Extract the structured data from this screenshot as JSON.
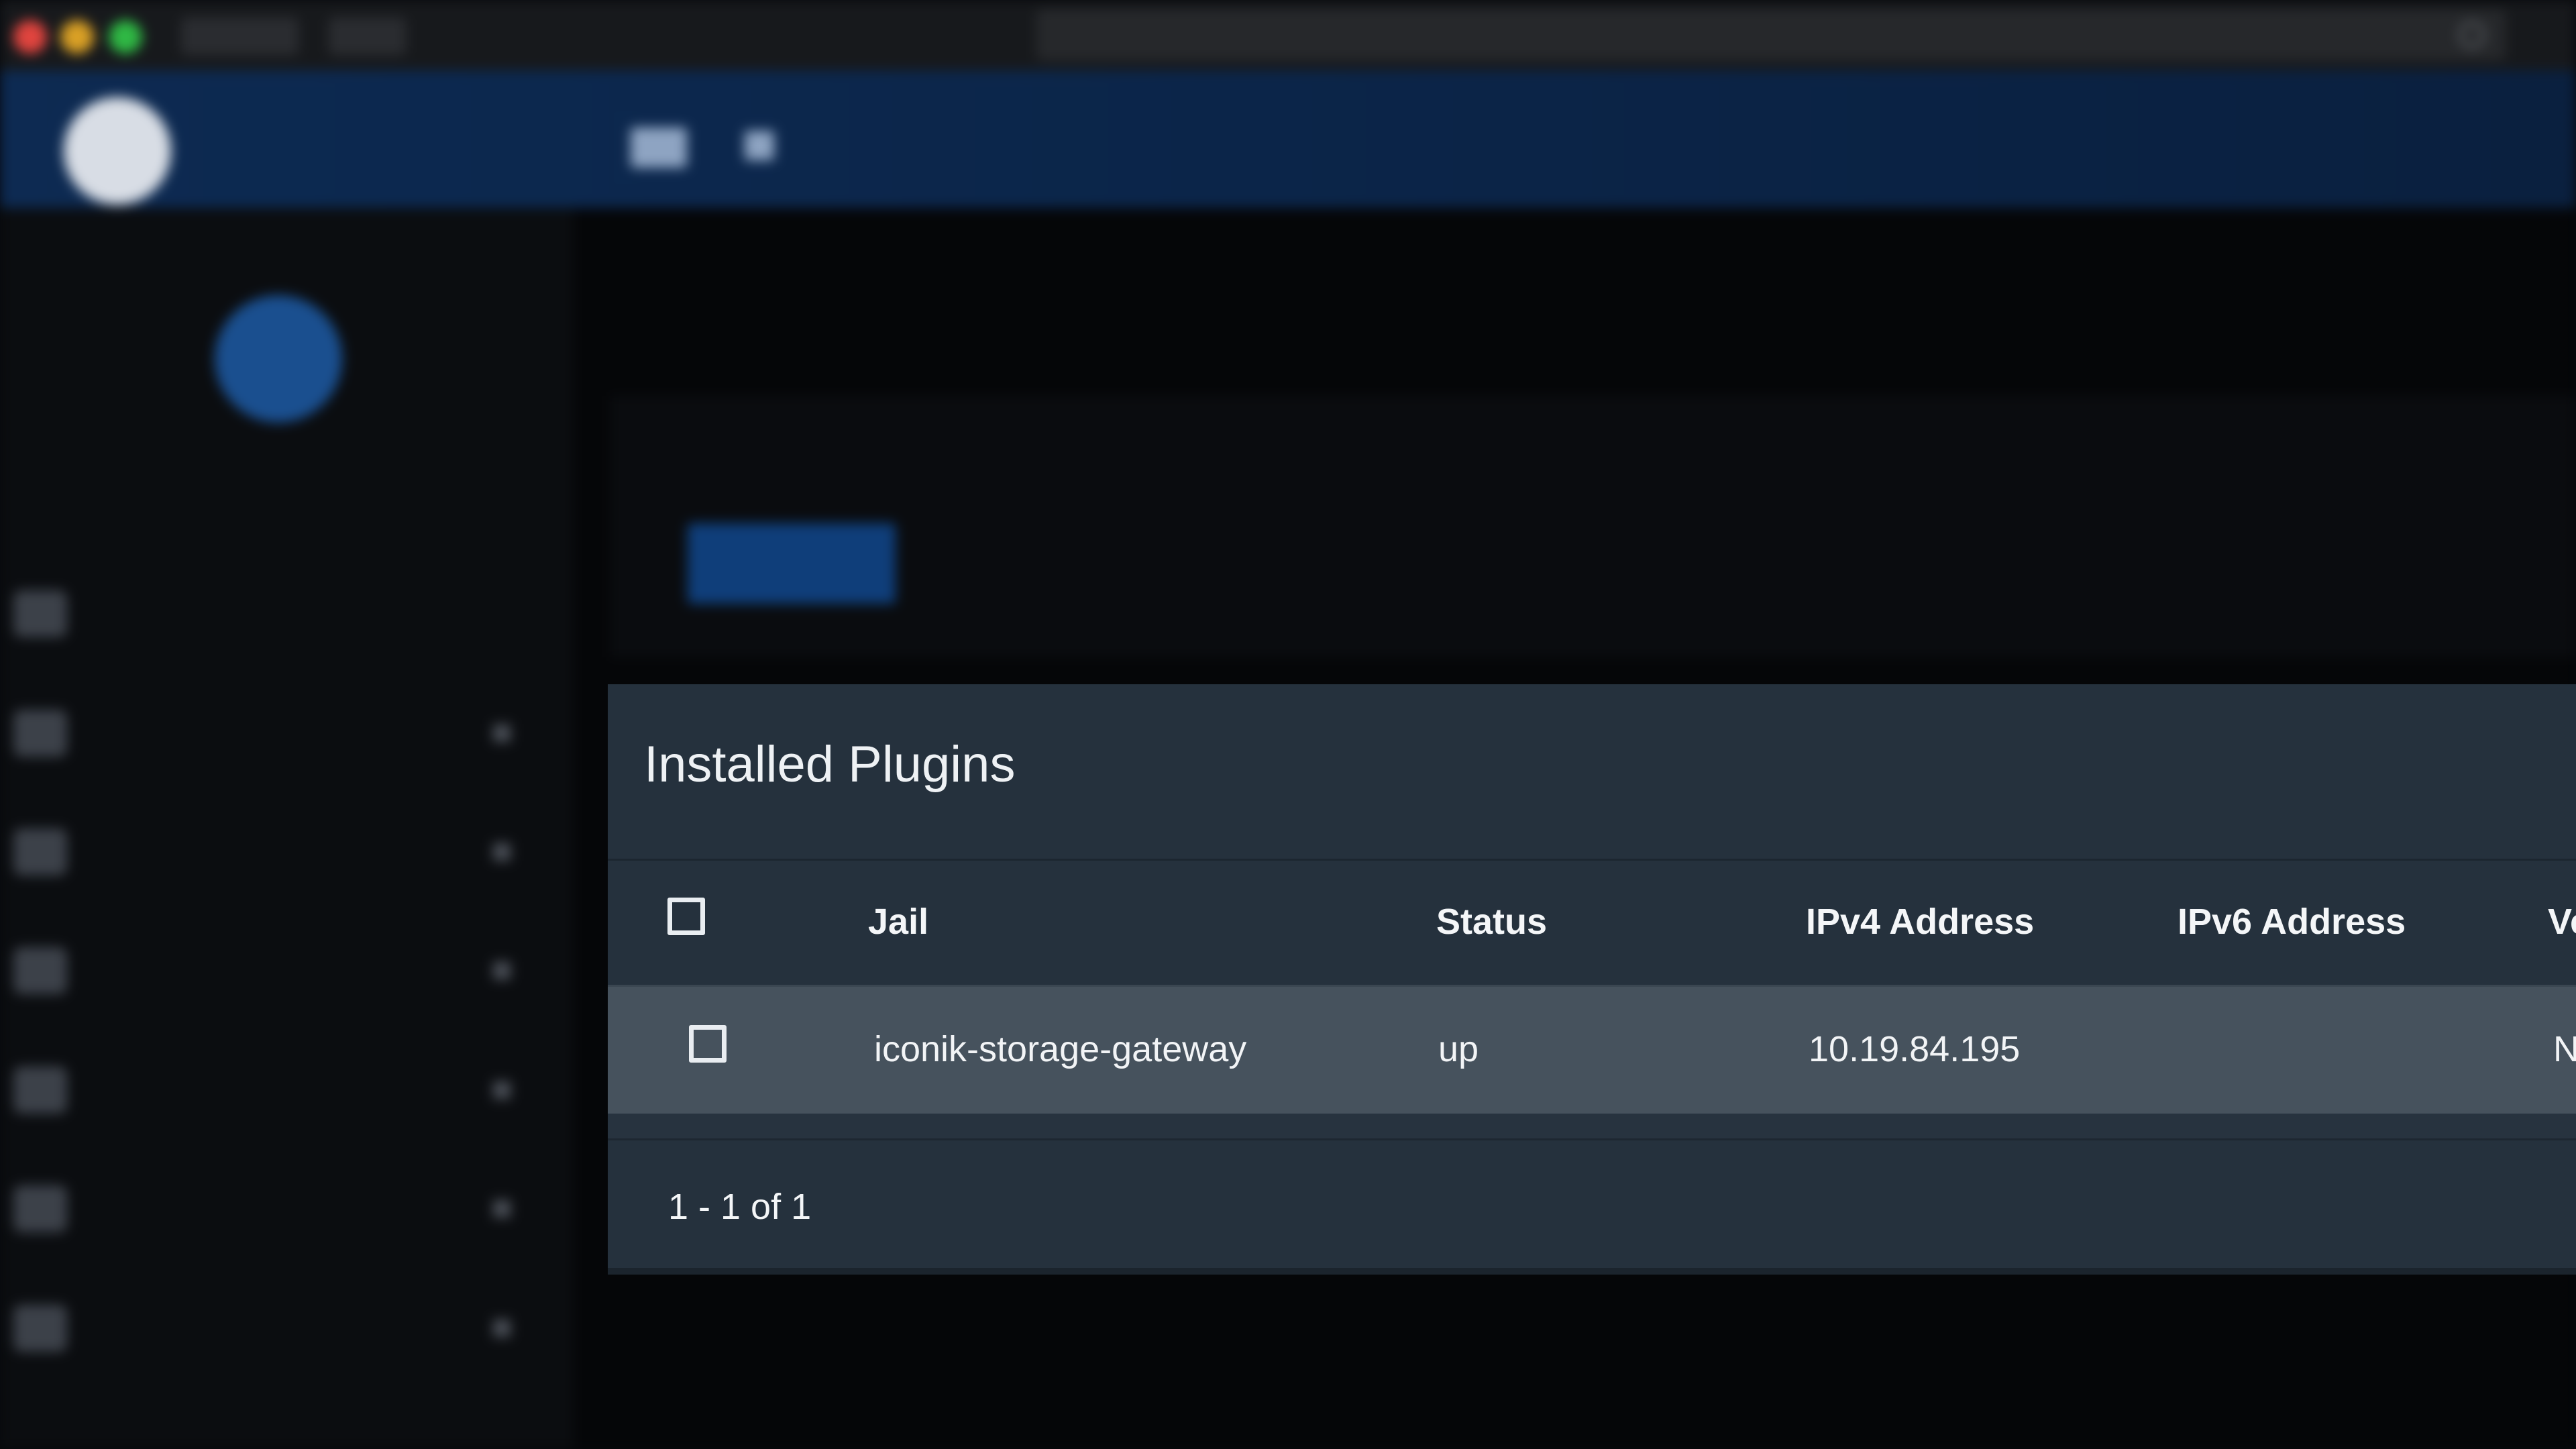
{
  "panel": {
    "title": "Installed Plugins",
    "columns": [
      "Jail",
      "Status",
      "IPv4 Address",
      "IPv6 Address",
      "Ve"
    ],
    "rows": [
      {
        "jail": "iconik-storage-gateway",
        "status": "up",
        "ipv4": "10.19.84.195",
        "ipv6": "",
        "version": "N"
      }
    ],
    "pagination": "1 - 1 of 1"
  },
  "colors": {
    "panel_bg": "#25313d",
    "row_bg": "#46525d",
    "nav_bar": "#0d2a52",
    "text": "#f4f6f8"
  },
  "icons": [
    "select-all-checkbox",
    "row-checkbox",
    "freenas-logo-icon"
  ]
}
